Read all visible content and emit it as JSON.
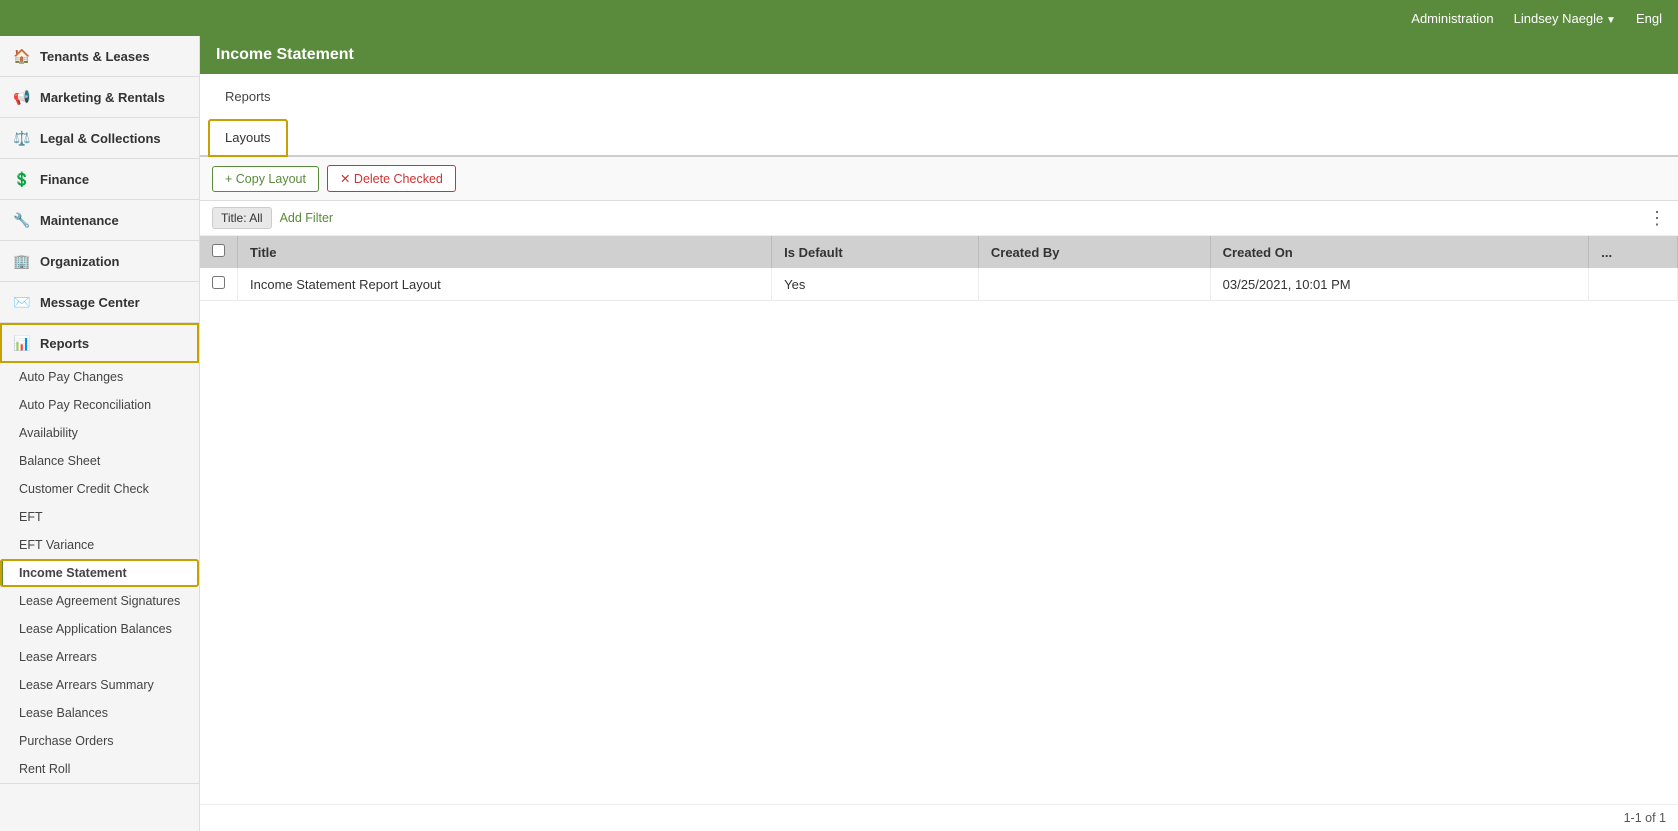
{
  "topbar": {
    "admin_label": "Administration",
    "user_label": "Lindsey Naegle",
    "lang_label": "Engl"
  },
  "sidebar": {
    "sections": [
      {
        "id": "tenants-leases",
        "label": "Tenants & Leases",
        "icon": "🏠",
        "active": false
      },
      {
        "id": "marketing-rentals",
        "label": "Marketing & Rentals",
        "icon": "📢",
        "active": false
      },
      {
        "id": "legal-collections",
        "label": "Legal & Collections",
        "icon": "⚖️",
        "active": false
      },
      {
        "id": "finance",
        "label": "Finance",
        "icon": "💲",
        "active": false
      },
      {
        "id": "maintenance",
        "label": "Maintenance",
        "icon": "🔧",
        "active": false
      },
      {
        "id": "organization",
        "label": "Organization",
        "icon": "🏢",
        "active": false
      },
      {
        "id": "message-center",
        "label": "Message Center",
        "icon": "✉️",
        "active": false
      }
    ],
    "reports_section": {
      "label": "Reports",
      "items": [
        {
          "id": "auto-pay-changes",
          "label": "Auto Pay Changes"
        },
        {
          "id": "auto-pay-reconciliation",
          "label": "Auto Pay Reconciliation"
        },
        {
          "id": "availability",
          "label": "Availability"
        },
        {
          "id": "balance-sheet",
          "label": "Balance Sheet"
        },
        {
          "id": "customer-credit-check",
          "label": "Customer Credit Check"
        },
        {
          "id": "eft",
          "label": "EFT"
        },
        {
          "id": "eft-variance",
          "label": "EFT Variance"
        },
        {
          "id": "income-statement",
          "label": "Income Statement",
          "active": true
        },
        {
          "id": "lease-agreement-signatures",
          "label": "Lease Agreement Signatures"
        },
        {
          "id": "lease-application-balances",
          "label": "Lease Application Balances"
        },
        {
          "id": "lease-arrears",
          "label": "Lease Arrears"
        },
        {
          "id": "lease-arrears-summary",
          "label": "Lease Arrears Summary"
        },
        {
          "id": "lease-balances",
          "label": "Lease Balances"
        },
        {
          "id": "purchase-orders",
          "label": "Purchase Orders"
        },
        {
          "id": "rent-roll",
          "label": "Rent Roll"
        }
      ]
    }
  },
  "page": {
    "title": "Income Statement",
    "tabs": [
      {
        "id": "reports",
        "label": "Reports"
      },
      {
        "id": "layouts",
        "label": "Layouts",
        "active": true
      }
    ]
  },
  "toolbar": {
    "copy_layout_label": "+ Copy Layout",
    "delete_checked_label": "✕ Delete Checked"
  },
  "filter": {
    "tag_label": "Title: All",
    "add_filter_label": "Add Filter"
  },
  "table": {
    "columns": [
      {
        "id": "checkbox",
        "label": ""
      },
      {
        "id": "title",
        "label": "Title"
      },
      {
        "id": "is_default",
        "label": "Is Default"
      },
      {
        "id": "created_by",
        "label": "Created By"
      },
      {
        "id": "created_on",
        "label": "Created On"
      },
      {
        "id": "actions",
        "label": "..."
      }
    ],
    "rows": [
      {
        "title": "Income Statement Report Layout",
        "is_default": "Yes",
        "created_by": "",
        "created_on": "03/25/2021, 10:01 PM"
      }
    ]
  },
  "pagination": {
    "label": "1-1 of 1"
  }
}
